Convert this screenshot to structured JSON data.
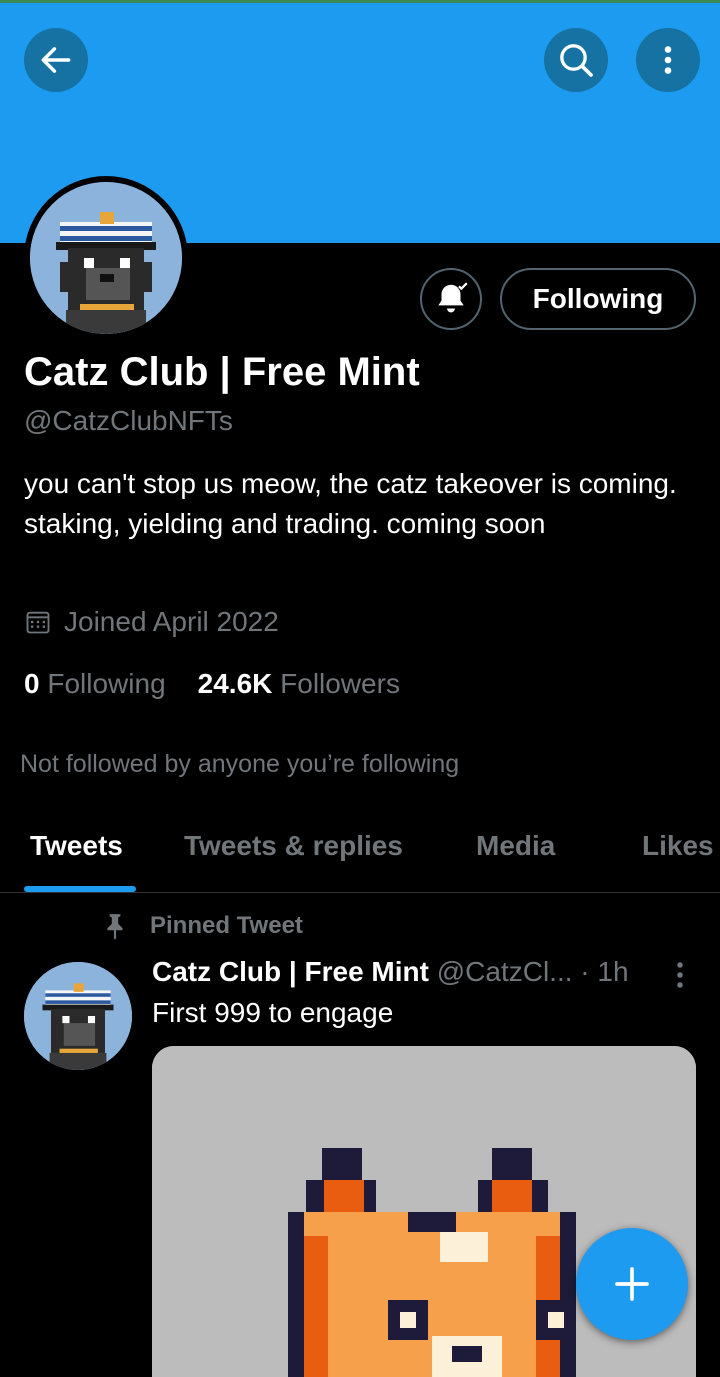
{
  "colors": {
    "accent": "#1d9bf0",
    "muted": "#71767b",
    "background": "#000000"
  },
  "header": {
    "back_icon": "arrow-left-icon",
    "search_icon": "search-icon",
    "more_icon": "more-vertical-icon"
  },
  "profile": {
    "display_name": "Catz Club | Free Mint",
    "handle": "@CatzClubNFTs",
    "bio": "you can't stop us meow, the catz takeover is coming. staking, yielding and trading. coming soon",
    "joined": "Joined April 2022",
    "following_count": "0",
    "following_label": "Following",
    "followers_count": "24.6K",
    "followers_label": "Followers",
    "not_followed": "Not followed by anyone you’re following",
    "follow_button": "Following",
    "bell_icon": "bell-check-icon"
  },
  "tabs": [
    {
      "label": "Tweets",
      "active": true
    },
    {
      "label": "Tweets & replies",
      "active": false
    },
    {
      "label": "Media",
      "active": false
    },
    {
      "label": "Likes",
      "active": false
    }
  ],
  "pinned_tweet": {
    "pinned_label": "Pinned Tweet",
    "author": "Catz Club | Free Mint",
    "handle": "@CatzCl...",
    "time": "· 1h",
    "text": "First 999 to engage"
  },
  "fab": {
    "icon": "plus-icon"
  }
}
